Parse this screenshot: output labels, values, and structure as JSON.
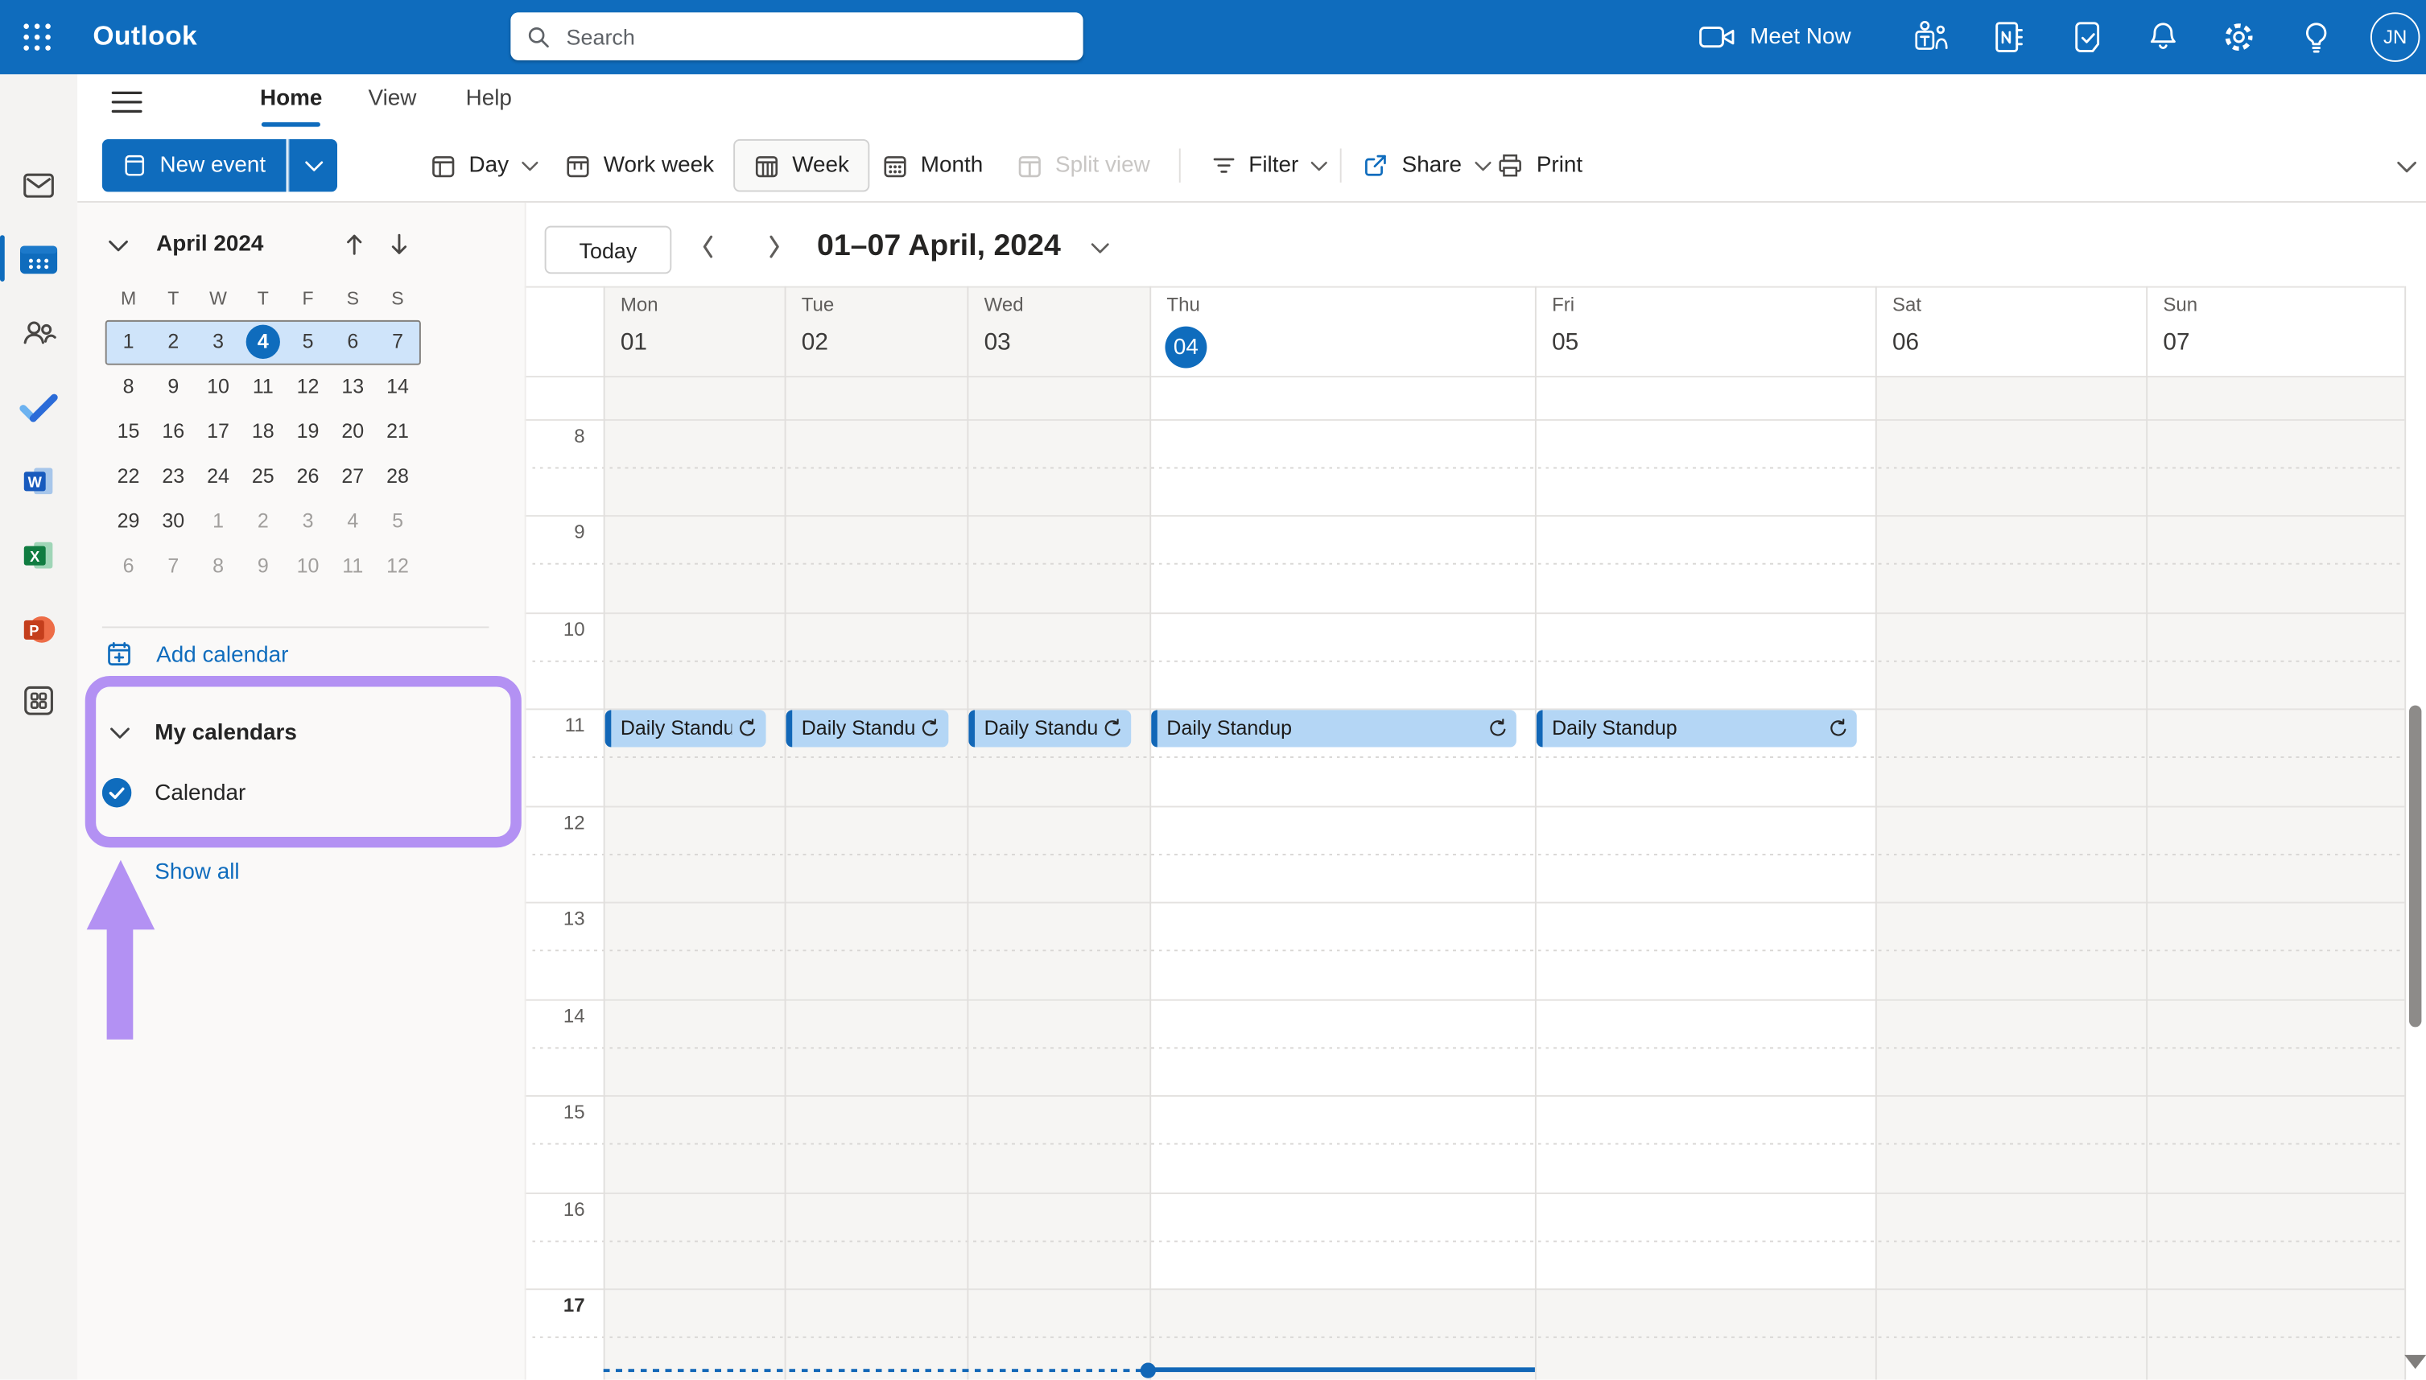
{
  "colors": {
    "brand_blue": "#0f6cbd",
    "event_fill": "#b4d6f5",
    "event_bar": "#1267b7",
    "annotation_purple": "#b391f3",
    "selected_week_bg": "#cfe4fa",
    "shaded_column": "#f6f5f3"
  },
  "topbar": {
    "app": "Outlook",
    "search_placeholder": "Search",
    "meet_now": "Meet Now",
    "avatar_initials": "JN",
    "icons": [
      "waffle-icon",
      "video-camera-icon",
      "teams-icon",
      "onenote-icon",
      "note-check-icon",
      "bell-icon",
      "gear-icon",
      "lightbulb-icon"
    ]
  },
  "ribbon": {
    "tabs": [
      {
        "label": "Home",
        "active": true
      },
      {
        "label": "View",
        "active": false
      },
      {
        "label": "Help",
        "active": false
      }
    ]
  },
  "toolbar": {
    "new_event": "New event",
    "views": [
      {
        "label": "Day",
        "chevron": true
      },
      {
        "label": "Work week"
      },
      {
        "label": "Week",
        "selected": true
      },
      {
        "label": "Month"
      },
      {
        "label": "Split view",
        "disabled": true
      }
    ],
    "filter": "Filter",
    "share": "Share",
    "print": "Print"
  },
  "left_rail": {
    "items": [
      "mail",
      "calendar",
      "people",
      "todo",
      "word",
      "excel",
      "powerpoint",
      "more-apps"
    ],
    "selected": "calendar"
  },
  "mini_calendar": {
    "title": "April 2024",
    "weekdays": [
      "M",
      "T",
      "W",
      "T",
      "F",
      "S",
      "S"
    ],
    "weeks": [
      [
        "1",
        "2",
        "3",
        "4",
        "5",
        "6",
        "7"
      ],
      [
        "8",
        "9",
        "10",
        "11",
        "12",
        "13",
        "14"
      ],
      [
        "15",
        "16",
        "17",
        "18",
        "19",
        "20",
        "21"
      ],
      [
        "22",
        "23",
        "24",
        "25",
        "26",
        "27",
        "28"
      ],
      [
        "29",
        "30",
        "1",
        "2",
        "3",
        "4",
        "5"
      ],
      [
        "6",
        "7",
        "8",
        "9",
        "10",
        "11",
        "12"
      ]
    ],
    "muted": {
      "4": [
        2,
        3,
        4,
        5,
        6
      ],
      "5": [
        0,
        1,
        2,
        3,
        4,
        5,
        6
      ]
    },
    "selected_week": 0,
    "today": [
      0,
      3
    ]
  },
  "sidebar": {
    "add_calendar": "Add calendar",
    "my_calendars": "My calendars",
    "calendars": [
      {
        "name": "Calendar",
        "checked": true
      }
    ],
    "show_all": "Show all"
  },
  "calendar": {
    "today_button": "Today",
    "range": "01–07 April, 2024",
    "days": [
      {
        "name": "Mon",
        "date": "01",
        "past": true
      },
      {
        "name": "Tue",
        "date": "02",
        "past": true
      },
      {
        "name": "Wed",
        "date": "03",
        "past": true
      },
      {
        "name": "Thu",
        "date": "04",
        "today": true
      },
      {
        "name": "Fri",
        "date": "05"
      },
      {
        "name": "Sat",
        "date": "06",
        "weekend": true
      },
      {
        "name": "Sun",
        "date": "07",
        "weekend": true
      }
    ],
    "hours": [
      "8",
      "9",
      "10",
      "11",
      "12",
      "13",
      "14",
      "15",
      "16",
      "17"
    ],
    "current_hour_index": 9,
    "events": [
      {
        "day": 0,
        "title": "Daily Standup",
        "start": "11:00",
        "end": "11:30",
        "recurring": true
      },
      {
        "day": 1,
        "title": "Daily Standup",
        "start": "11:00",
        "end": "11:30",
        "recurring": true
      },
      {
        "day": 2,
        "title": "Daily Standup",
        "start": "11:00",
        "end": "11:30",
        "recurring": true
      },
      {
        "day": 3,
        "title": "Daily Standup",
        "start": "11:00",
        "end": "11:30",
        "recurring": true
      },
      {
        "day": 4,
        "title": "Daily Standup",
        "start": "11:00",
        "end": "11:30",
        "recurring": true
      }
    ]
  }
}
